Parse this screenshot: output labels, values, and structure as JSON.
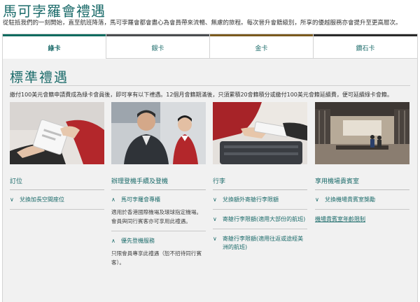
{
  "page": {
    "title": "馬可孛羅會禮遇",
    "intro": "從駐抵我們的一刻開始，直至航班降落，馬可孛羅會都會盡心為會員帶來流暢、無慮的旅程。每次晉升會籍級別，所享的優越服務亦會提升至更高層次。"
  },
  "tabs": [
    {
      "label": "綠卡",
      "color": "#0b6b5f"
    },
    {
      "label": "銀卡",
      "color": "#4a4d50"
    },
    {
      "label": "金卡",
      "color": "#7a5a1e"
    },
    {
      "label": "鑽石卡",
      "color": "#2a2a2a"
    }
  ],
  "section": {
    "title": "標準禮遇",
    "description": "繳付100美元會籍申請費成為綠卡會員後，即可享有以下禮遇。12個月會籍期滿後，只須累積20會籍積分或繳付100美元會籍延續費，便可延續綠卡會籍。"
  },
  "columns": [
    {
      "heading": "訂位",
      "items": [
        {
          "label": "兌換加長空間座位",
          "expanded": false
        }
      ]
    },
    {
      "heading": "辦理登機手續及登機",
      "items": [
        {
          "label": "馬可孛羅會專櫃",
          "expanded": true,
          "body": "適用於香港國際機場及環球指定機場。會員與同行賓客亦可享用此禮遇。"
        },
        {
          "label": "優先登機服務",
          "expanded": true,
          "body": "只限會員專享此禮遇（恕不招待同行賓客）。"
        }
      ]
    },
    {
      "heading": "行李",
      "items": [
        {
          "label": "兌換額外寄艙行李限額",
          "expanded": false
        },
        {
          "label": "寄艙行李限額(適用大部份的航班)",
          "expanded": false
        },
        {
          "label": "寄艙行李限額(適用往返或途經美洲的航班)",
          "expanded": false
        }
      ]
    },
    {
      "heading": "享用機場貴賓室",
      "items": [
        {
          "label": "兌換機場貴賓室獎勵",
          "expanded": false
        },
        {
          "label": "機場貴賓室年齡限制",
          "expanded": false,
          "link": true
        }
      ]
    }
  ]
}
